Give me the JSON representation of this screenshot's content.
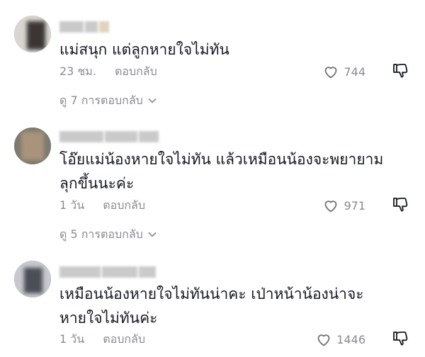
{
  "comments": [
    {
      "text": "แม่สนุก แต่ลูกหายใจไม่ทัน",
      "time": "23 ชม.",
      "reply_label": "ตอบกลับ",
      "likes": "744",
      "view_replies": "ดู 7 การตอบกลับ"
    },
    {
      "text": "โอ๊ยแม่น้องหายใจไม่ทัน แล้วเหมือนน้องจะพยายาม\nลุกขึ้นนะค่ะ",
      "time": "1 วัน",
      "reply_label": "ตอบกลับ",
      "likes": "971",
      "view_replies": "ดู 5 การตอบกลับ"
    },
    {
      "text": "เหมือนน้องหายใจไม่ทันน่าคะ เป่าหน้าน้องน่าจะ\nหายใจไม่ทันค่ะ",
      "time": "1 วัน",
      "reply_label": "ตอบกลับ",
      "likes": "1446"
    }
  ],
  "icons": {
    "like": "heart-outline-icon",
    "dislike": "thumbs-down-icon",
    "expand": "chevron-down-icon"
  },
  "colors": {
    "text": "#161823",
    "muted": "#8a8b91"
  }
}
